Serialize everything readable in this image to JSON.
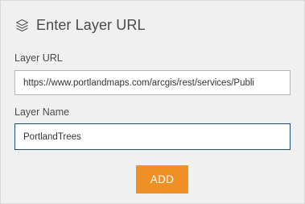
{
  "header": {
    "icon": "layers-icon",
    "title": "Enter Layer URL"
  },
  "form": {
    "url": {
      "label": "Layer URL",
      "value": "https://www.portlandmaps.com/arcgis/rest/services/Publi"
    },
    "name": {
      "label": "Layer Name",
      "value": "PortlandTrees"
    }
  },
  "actions": {
    "add_label": "ADD"
  },
  "colors": {
    "panel_bg": "#f0f0f0",
    "button_accent": "#f08f25",
    "focused_border": "#1f4e79"
  }
}
